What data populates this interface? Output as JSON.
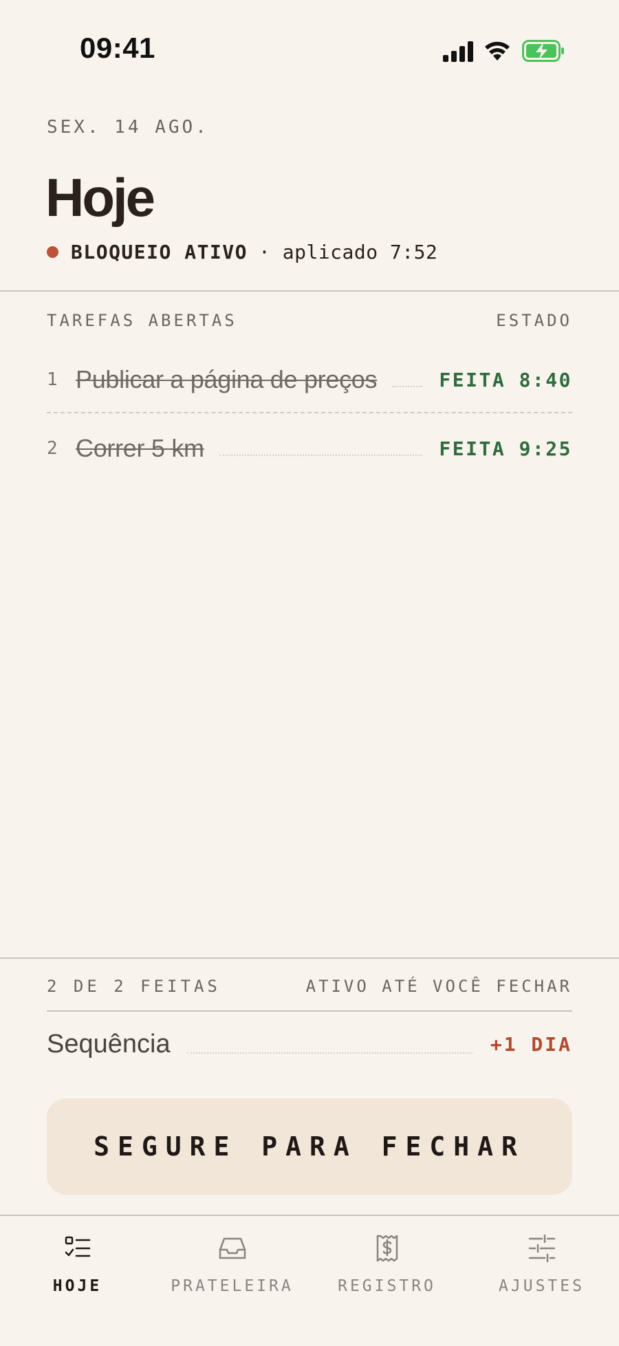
{
  "status_bar": {
    "time": "09:41",
    "icons": [
      "signal-icon",
      "wifi-icon",
      "battery-charging-icon"
    ],
    "battery_color": "#4cc35a"
  },
  "header": {
    "date": "SEX. 14 AGO.",
    "title": "Hoje",
    "block_status": "BLOQUEIO ATIVO",
    "block_detail": "· aplicado 7:52",
    "block_color": "#b95236"
  },
  "tasks": {
    "header_left": "TAREFAS ABERTAS",
    "header_right": "ESTADO",
    "items": [
      {
        "num": "1",
        "title": "Publicar a página de preços",
        "status": "FEITA 8:40"
      },
      {
        "num": "2",
        "title": "Correr 5 km",
        "status": "FEITA 9:25"
      }
    ],
    "done_color": "#2f6b3f"
  },
  "footer": {
    "count": "2 DE 2 FEITAS",
    "active_until": "ATIVO ATÉ VOCÊ FECHAR",
    "streak_label": "Sequência",
    "streak_value": "+1 DIA",
    "streak_color": "#b24a2f",
    "hold_button": "SEGURE PARA FECHAR"
  },
  "tabbar": {
    "items": [
      {
        "label": "HOJE",
        "icon": "checklist-icon",
        "active": true
      },
      {
        "label": "PRATELEIRA",
        "icon": "inbox-tray-icon",
        "active": false
      },
      {
        "label": "REGISTRO",
        "icon": "receipt-dollar-icon",
        "active": false
      },
      {
        "label": "AJUSTES",
        "icon": "sliders-icon",
        "active": false
      }
    ]
  }
}
